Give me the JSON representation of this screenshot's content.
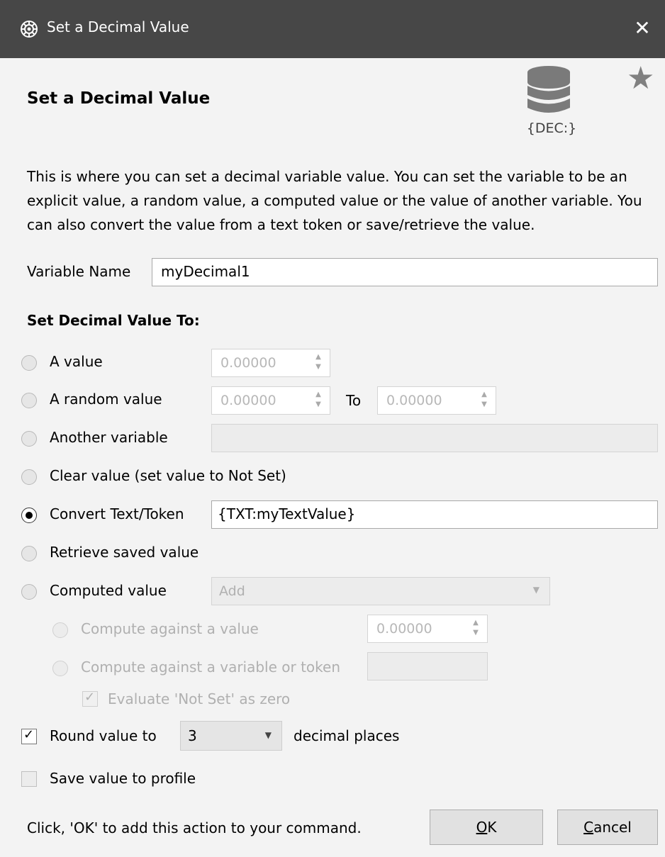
{
  "window": {
    "title": "Set a Decimal Value",
    "close_glyph": "✕",
    "app_icon": "gear-icon"
  },
  "header": {
    "heading": "Set a Decimal Value",
    "star_glyph": "★",
    "icon_label": "{DEC:}",
    "icon": "database-icon"
  },
  "description": "This is where you can set a decimal variable value.  You can set the variable to be an explicit value, a random value, a computed value or the value of another variable.  You can also convert the value from a text token or save/retrieve the value.",
  "variable_name": {
    "label": "Variable Name",
    "value": "myDecimal1"
  },
  "set_section": {
    "title": "Set Decimal Value To:",
    "options": [
      {
        "label": "A value",
        "checked": false
      },
      {
        "label": "A random value",
        "checked": false
      },
      {
        "label": "Another variable",
        "checked": false
      },
      {
        "label": "Clear value (set value to Not Set)",
        "checked": false
      },
      {
        "label": "Convert Text/Token",
        "checked": true
      },
      {
        "label": "Retrieve saved value",
        "checked": false
      },
      {
        "label": "Computed value",
        "checked": false
      }
    ],
    "a_value": "0.00000",
    "random_from": "0.00000",
    "random_to_label": "To",
    "random_to": "0.00000",
    "convert_value": "{TXT:myTextValue}",
    "computed_operation": "Add",
    "compute_against_value_label": "Compute against a value",
    "compute_against_value": "0.00000",
    "compute_against_variable_label": "Compute against a variable or token",
    "evaluate_not_set_label": "Evaluate 'Not Set' as zero"
  },
  "round": {
    "label": "Round value to",
    "checked": true,
    "value": "3",
    "suffix": "decimal places"
  },
  "save_profile": {
    "label": "Save value to profile",
    "checked": false
  },
  "footer": {
    "hint": "Click, 'OK' to add this action to your command.",
    "ok_label": "OK",
    "cancel_label": "Cancel"
  }
}
